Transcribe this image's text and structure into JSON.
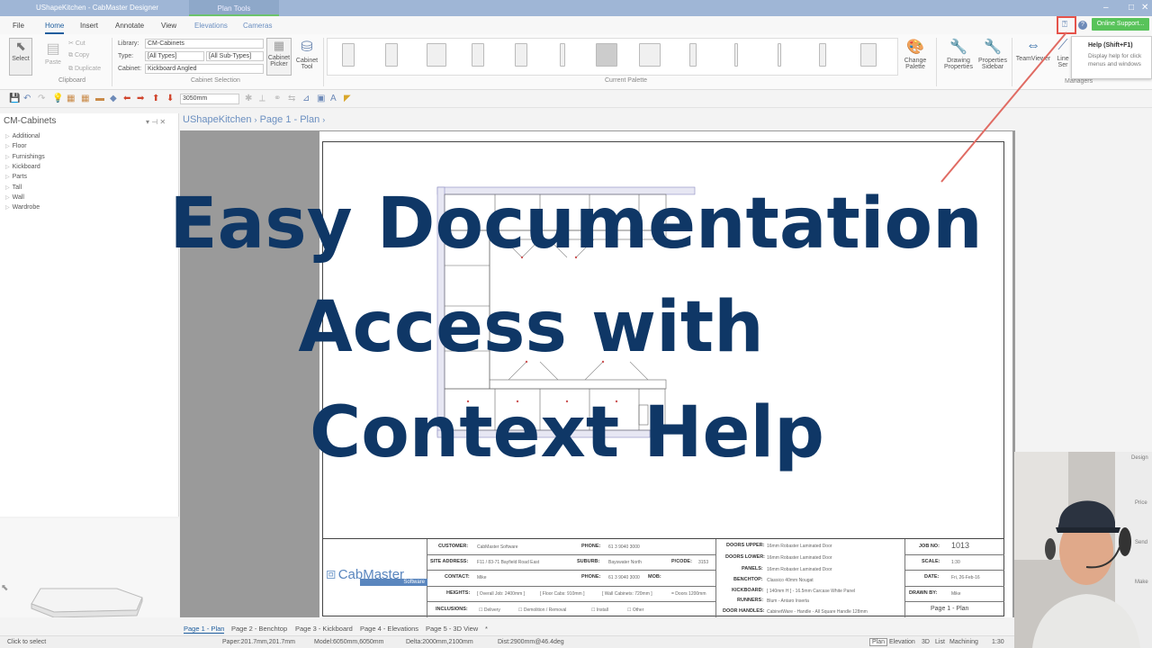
{
  "window": {
    "title": "UShapeKitchen - CabMaster Designer",
    "context_tab": "Plan Tools"
  },
  "menu": {
    "tabs": [
      "File",
      "Home",
      "Insert",
      "Annotate",
      "View",
      "Elevations",
      "Cameras"
    ],
    "online_support": "Online Support..."
  },
  "ribbon": {
    "select": "Select",
    "paste": "Paste",
    "cut": "Cut",
    "copy": "Copy",
    "duplicate": "Duplicate",
    "clipboard_group": "Clipboard",
    "library_label": "Library:",
    "library_value": "CM-Cabinets",
    "type_label": "Type:",
    "type_value": "[All Types]",
    "subtype_value": "[All Sub-Types]",
    "cabinet_label": "Cabinet:",
    "cabinet_value": "Kickboard Angled",
    "cabinet_picker": "Cabinet Picker",
    "cabinet_tool": "Cabinet Tool",
    "cabinet_selection_group": "Cabinet Selection",
    "current_palette_group": "Current Palette",
    "change_palette": "Change Palette",
    "drawing_properties": "Drawing Properties",
    "properties_sidebar": "Properties Sidebar",
    "teamviewer": "TeamViewer",
    "line_ser": "Line Ser",
    "managers_group": "Managers"
  },
  "tooltip": {
    "title": "Help (Shift+F1)",
    "desc": "Display help for click menus and windows"
  },
  "toolbar": {
    "dimension_value": "3050mm"
  },
  "left_panel": {
    "title": "CM-Cabinets",
    "items": [
      "Additional",
      "Floor",
      "Furnishings",
      "Kickboard",
      "Parts",
      "Tall",
      "Wall",
      "Wardrobe"
    ]
  },
  "document": {
    "breadcrumb_doc": "UShapeKitchen",
    "breadcrumb_sep": "›",
    "breadcrumb_page": "Page 1 - Plan"
  },
  "titleblock": {
    "customer_lbl": "CUSTOMER:",
    "customer_val": "CabMaster Software",
    "phone_lbl": "PHONE:",
    "phone_val": "61 3 9040 3000",
    "site_lbl": "SITE ADDRESS:",
    "site_val": "F11 / 83-71 Bayfield Road East",
    "suburb_lbl": "SUBURB:",
    "suburb_val": "Bayswater North",
    "postcode_lbl": "P/CODE:",
    "postcode_val": "3153",
    "contact_lbl": "CONTACT:",
    "contact_val": "Mike",
    "phone2_lbl": "PHONE:",
    "phone2_val": "61 3 9040 3000",
    "mob_lbl": "MOB:",
    "heights_lbl": "HEIGHTS:",
    "heights_val1": "[ Overall Job: 2400mm ]",
    "heights_val2": "[ Floor Cabs: 910mm ]",
    "heights_val3": "[ Wall Cabinets: 720mm ]",
    "heights_val4": "= Doors 1200mm",
    "inclusions_lbl": "INCLUSIONS:",
    "inc1": "Delivery",
    "inc2": "Demolition / Removal",
    "inc3": "Install",
    "inc4": "Other",
    "doors_upper_lbl": "DOORS UPPER:",
    "doors_upper_val": "16mm Robaster Laminated Door",
    "doors_lower_lbl": "DOORS LOWER:",
    "doors_lower_val": "16mm Robaster Laminated Door",
    "panels_lbl": "PANELS:",
    "panels_val": "16mm Robaster Laminated Door",
    "benchtop_lbl": "BENCHTOP:",
    "benchtop_val": "Classico 40mm Nougat",
    "kickboard_lbl": "KICKBOARD:",
    "kickboard_val": "[ 140mm H ] - 16.5mm Carcase White Panel",
    "runners_lbl": "RUNNERS:",
    "runners_val": "Blum - Antaro Inserta",
    "handles_lbl": "DOOR HANDLES:",
    "handles_val": "CabinetWare - Handle - All Square Handle 128mm",
    "job_lbl": "JOB NO:",
    "job_val": "1013",
    "scale_lbl": "SCALE:",
    "scale_val": "1:30",
    "date_lbl": "DATE:",
    "date_val": "Fri, 26-Feb-16",
    "drawn_lbl": "DRAWN BY:",
    "drawn_val": "Mike",
    "page_val": "Page 1 - Plan",
    "logo_text": "CabMaster",
    "logo_sub": "Software"
  },
  "overlay": {
    "line1": "Easy Documentation",
    "line2": "Access with",
    "line3": "Context Help"
  },
  "page_tabs": [
    "Page 1 - Plan",
    "Page 2 - Benchtop",
    "Page 3 - Kickboard",
    "Page 4 - Elevations",
    "Page 5 - 3D View",
    "*"
  ],
  "status": {
    "left": "Click to select",
    "paper": "Paper:201.7mm,201.7mm",
    "model": "Model:6050mm,6050mm",
    "delta": "Delta:2000mm,2100mm",
    "dist": "Dist:2900mm@46.4deg",
    "views": [
      "Plan",
      "Elevation",
      "3D",
      "List",
      "Machining"
    ],
    "scale": "1:30"
  },
  "webcam": {
    "sidebar_labels": [
      "Design",
      "Price",
      "Send",
      "Make"
    ]
  },
  "colors": {
    "heading": "#0f3766",
    "accent": "#1f5e9e",
    "online_support": "#58c35a",
    "highlight": "#e5534b"
  }
}
